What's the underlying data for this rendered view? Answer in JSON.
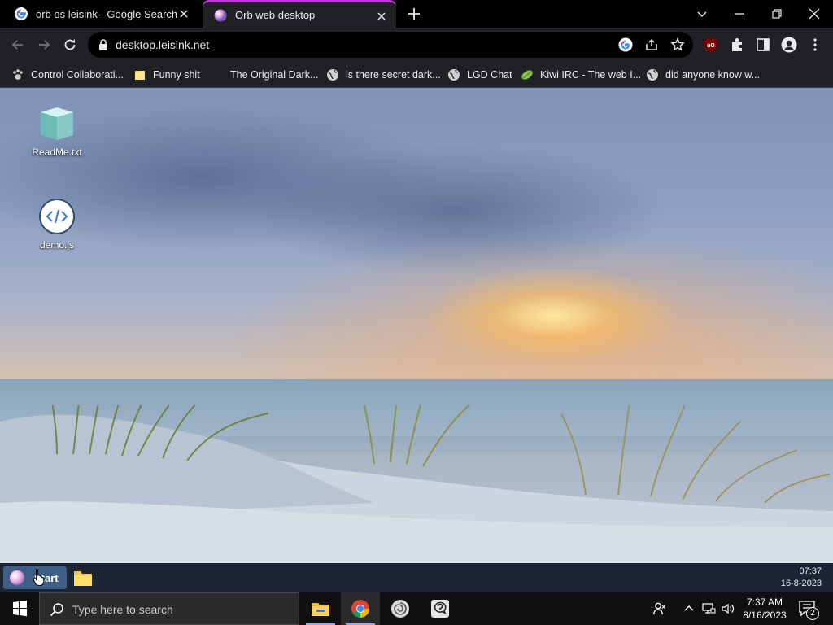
{
  "browser": {
    "tabs": [
      {
        "title": "orb os leisink - Google Search",
        "active": false
      },
      {
        "title": "Orb web desktop",
        "active": true
      }
    ],
    "url": "desktop.leisink.net",
    "active_tab_accent": "#c13bd8"
  },
  "bookmarks": [
    {
      "label": "Control Collaborati...",
      "icon": "pawprint-icon"
    },
    {
      "label": "Funny shit",
      "icon": "folder-icon"
    },
    {
      "label": "The Original Dark...",
      "icon": "blank-icon"
    },
    {
      "label": "is there secret dark...",
      "icon": "globe-icon"
    },
    {
      "label": "LGD Chat",
      "icon": "globe-icon"
    },
    {
      "label": "Kiwi IRC - The web I...",
      "icon": "kiwi-icon"
    },
    {
      "label": "did anyone know w...",
      "icon": "globe-icon"
    }
  ],
  "desktop": {
    "icons": [
      {
        "label": "ReadMe.txt",
        "icon": "text-file-icon"
      },
      {
        "label": "demo.js",
        "icon": "code-file-icon"
      }
    ]
  },
  "orb_taskbar": {
    "start_label": "Start",
    "clock_time": "07:37",
    "clock_date": "16-8-2023"
  },
  "windows_taskbar": {
    "search_placeholder": "Type here to search",
    "time": "7:37 AM",
    "date": "8/16/2023",
    "notification_count": "2",
    "apps": [
      "file-explorer-icon",
      "chrome-icon",
      "app-swirl-icon",
      "app-chat-icon"
    ]
  }
}
